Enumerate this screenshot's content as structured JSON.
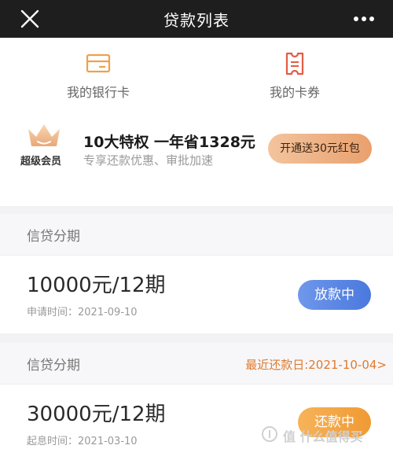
{
  "header": {
    "title": "贷款列表"
  },
  "quick_links": [
    {
      "label": "我的银行卡",
      "icon": "bank-card-icon"
    },
    {
      "label": "我的卡券",
      "icon": "coupon-icon"
    }
  ],
  "vip": {
    "label": "超级会员",
    "headline": "10大特权 一年省1328元",
    "subtitle": "专享还款优惠、审批加速",
    "cta": "开通送30元红包"
  },
  "loans": [
    {
      "category": "信贷分期",
      "amount": "10000元/12期",
      "date": "申请时间：2021-09-10",
      "status": "放款中",
      "due": ""
    },
    {
      "category": "信贷分期",
      "amount": "30000元/12期",
      "date": "起息时间：2021-03-10",
      "status": "还款中",
      "due": "最近还款日:2021-10-04>"
    }
  ],
  "watermark": {
    "text": "值 什么值得买"
  },
  "colors": {
    "accent_orange": "#e07a2c",
    "button_blue": "#4b78de",
    "button_orange": "#f09a33",
    "topbar": "#1e1e1f"
  }
}
